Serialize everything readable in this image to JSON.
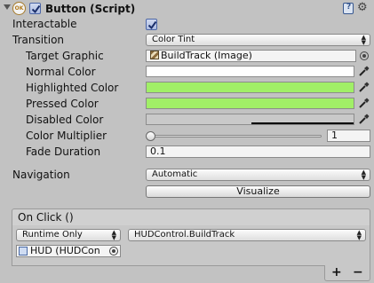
{
  "component": {
    "title": "Button (Script)",
    "enabled": true,
    "ok_icon_text": "OK",
    "help_icon": "help-book-icon",
    "settings_icon": "gear-icon"
  },
  "interactable": {
    "label": "Interactable",
    "checked": true
  },
  "transition": {
    "label": "Transition",
    "value": "Color Tint",
    "target_graphic": {
      "label": "Target Graphic",
      "value": "BuildTrack (Image)"
    },
    "normal_color": {
      "label": "Normal Color",
      "color": "#ffffff"
    },
    "highlighted_color": {
      "label": "Highlighted Color",
      "color": "#a1ef67"
    },
    "pressed_color": {
      "label": "Pressed Color",
      "color": "#a1ef67"
    },
    "disabled_color": {
      "label": "Disabled Color",
      "color": "#c9c9c9"
    },
    "color_multiplier": {
      "label": "Color Multiplier",
      "value": "1",
      "slider_fraction": 0.0
    },
    "fade_duration": {
      "label": "Fade Duration",
      "value": "0.1"
    }
  },
  "navigation": {
    "label": "Navigation",
    "value": "Automatic",
    "visualize_label": "Visualize"
  },
  "on_click": {
    "header": "On Click ()",
    "runtime_value": "Runtime Only",
    "function_value": "HUDControl.BuildTrack",
    "object_value": "HUD (HUDCon",
    "add_label": "+",
    "remove_label": "−"
  }
}
